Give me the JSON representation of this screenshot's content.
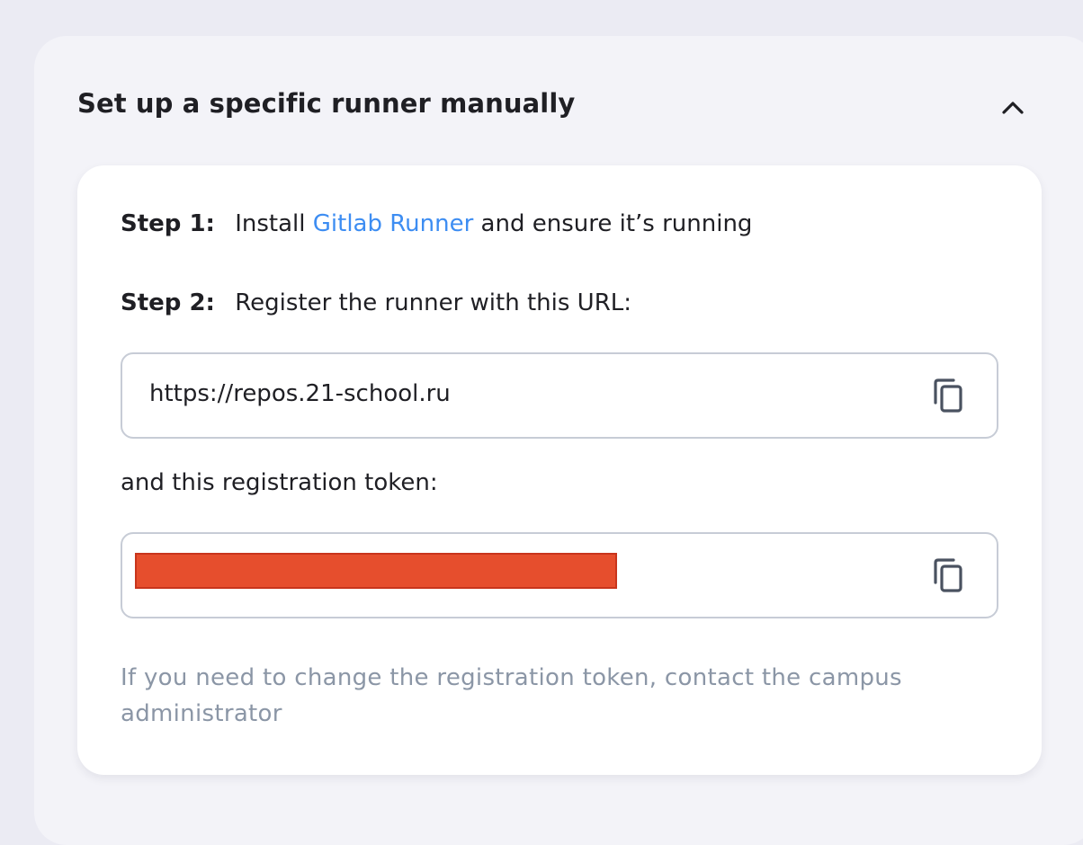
{
  "panel": {
    "title": "Set up a specific runner manually",
    "toggle_icon": "chevron-up-icon"
  },
  "steps": {
    "step1": {
      "label": "Step 1:",
      "prefix": "Install",
      "link_text": "Gitlab Runner",
      "suffix": "and ensure it’s running"
    },
    "step2": {
      "label": "Step 2:",
      "text": "Register the runner with this URL:"
    }
  },
  "url_field": {
    "value": "https://repos.21-school.ru",
    "copy_icon": "copy-icon"
  },
  "token": {
    "caption": "and this registration token:",
    "value_redacted": true,
    "copy_icon": "copy-icon"
  },
  "hint": "If you need to change the registration token, contact the campus administrator",
  "colors": {
    "link": "#3d8df2",
    "hint_text": "#8b96a6",
    "redaction": "#e64e2d"
  }
}
